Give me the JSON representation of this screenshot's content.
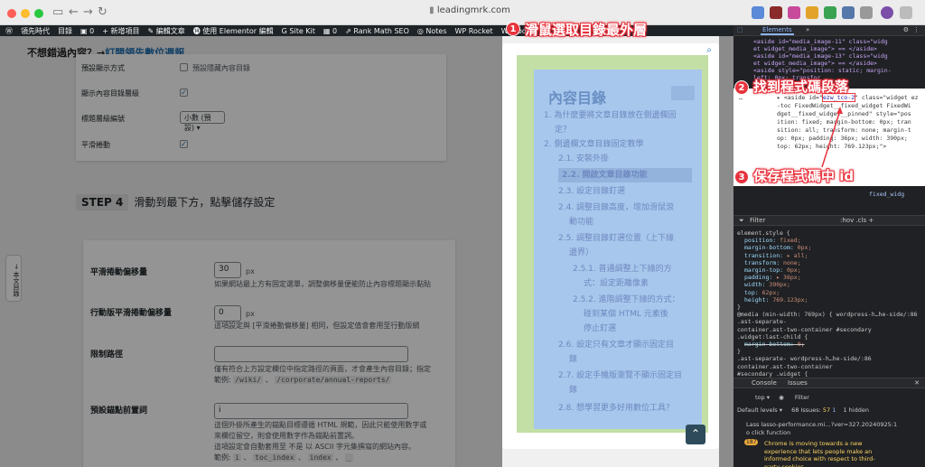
{
  "browser": {
    "url": "leadingmrk.com",
    "nav_icons": [
      "sidebar-icon",
      "back-icon",
      "forward-icon",
      "reload-icon"
    ]
  },
  "wpbar": {
    "items": [
      "領先時代",
      "目錄",
      "0",
      "新增項目",
      "編輯文章",
      "使用 Elementor 編輯",
      "Site Kit",
      "0",
      "Rank Math SEO",
      "Notes",
      "WP Rocket",
      "WPCode"
    ]
  },
  "page": {
    "notice_text": "不想錯過內容？→",
    "notice_link": "訂閱領先數位週報",
    "settings_top": [
      {
        "label": "預設顯示方式",
        "option": "預設隱藏內容目錄",
        "checked": false
      },
      {
        "label": "顯示內容目錄層級",
        "checked": true
      },
      {
        "label": "標題層級編號",
        "select": "小數 (預設)"
      },
      {
        "label": "平滑捲動",
        "checked": true
      }
    ],
    "step_badge": "STEP 4",
    "step_text": "滑動到最下方，點擊儲存設定",
    "smooth_offset_label": "平滑捲動偏移量",
    "smooth_offset_value": "30",
    "smooth_offset_unit": "px",
    "smooth_offset_help": "如果網站最上方有固定選單，調整偏移量便能防止內容標題顯示黏貼",
    "mobile_offset_label": "行動版平滑捲動偏移量",
    "mobile_offset_value": "0",
    "mobile_offset_unit": "px",
    "mobile_offset_help": "這項設定與 [平滑捲動偏移量] 相同，但設定值會套用至行動版網",
    "path_label": "限制路徑",
    "path_help": "僅有符合上方設定欄位中指定路徑的頁面，才會產生內容目錄；指定",
    "path_example_prefix": "範例:",
    "path_example_1": "/wiki/",
    "path_example_sep": "、",
    "path_example_2": "/corporate/annual-reports/",
    "anchor_label": "預設錨點前置詞",
    "anchor_value": "i",
    "anchor_help_1": "這個外掛所產生的錨點目標遵循 HTML 規範，因此只能使用數字或",
    "anchor_help_2": "來欄位留空，則會使用數字作為錨點前置詞。",
    "anchor_help_3": "這項設定會自動套用至 不是 以 ASCII 字元集撰寫的網站內容。",
    "anchor_example_prefix": "範例:",
    "anchor_example_1": "i",
    "anchor_example_2": "toc_index",
    "anchor_example_3": "index",
    "anchor_example_4": "_",
    "side_tab": "本文目錄"
  },
  "toc": {
    "title": "內容目錄",
    "items": [
      {
        "text": "1. 為什麼要將文章目錄放在側邊欄固"
      },
      {
        "text": "定？"
      },
      {
        "text": "2. 側邊欄文章目錄固定教學"
      },
      {
        "text": "2.1. 安裝外掛"
      },
      {
        "text": "2.2. 開啟文章目錄功能"
      },
      {
        "text": "2.3. 設定目錄釘選"
      },
      {
        "text": "2.4. 調整目錄高度，增加滑鼠滾"
      },
      {
        "text": "動功能"
      },
      {
        "text": "2.5. 調整目錄釘選位置（上下緣"
      },
      {
        "text": "邊界）"
      },
      {
        "text": "2.5.1. 普通調整上下緣的方"
      },
      {
        "text": "式：設定距離像素"
      },
      {
        "text": "2.5.2. 進階調整下緣的方式："
      },
      {
        "text": "碰到某個 HTML 元素後"
      },
      {
        "text": "停止釘選"
      },
      {
        "text": "2.6. 設定只有文章才顯示固定目"
      },
      {
        "text": "錄"
      },
      {
        "text": "2.7. 設定手機版瀏覽不顯示固定目"
      },
      {
        "text": "錄"
      },
      {
        "text": "2.8. 想學習更多好用數位工具？"
      }
    ]
  },
  "devtools": {
    "tab_elements": "Elements",
    "dom_lines": [
      "<aside id=\"media_image-11\" class=\"widg",
      "et widget_media_image\"> == </aside>",
      "<aside id=\"media_image-13\" class=\"widg",
      "et widget_media_image\"> == </aside>",
      "<aside style=\"position: static; margin-",
      "left: 0px; transfor",
      "adding: 36p",
      "display: bl"
    ],
    "hl_lines": [
      "▸ <aside id=\"ezw_tco-2\" class=\"widget ez",
      "-toc FixedWidget__fixed_widget FixedWi",
      "dget__fixed_widget__pinned\" style=\"pos",
      "ition: fixed; margin-bottom: 0px; tran",
      "sition: all; transform: none; margin-t",
      "op: 0px; padding: 36px; width: 390px;",
      "top: 62px; height: 769.123px;\">"
    ],
    "id_value": "ezw_tco-2",
    "mid_line": "fixed_widg",
    "filter_label": "Filter",
    "filter_tools": ":hov  .cls  +",
    "styles": [
      {
        "t": "element.style {"
      },
      {
        "p": "position",
        "v": "fixed;"
      },
      {
        "p": "margin-bottom",
        "v": "0px;"
      },
      {
        "p": "transition",
        "v": "▸ all;"
      },
      {
        "p": "transform",
        "v": "none;"
      },
      {
        "p": "margin-top",
        "v": "0px;"
      },
      {
        "p": "padding",
        "v": "▸ 36px;"
      },
      {
        "p": "width",
        "v": "390px;"
      },
      {
        "p": "top",
        "v": "62px;"
      },
      {
        "p": "height",
        "v": "769.123px;"
      },
      {
        "t": "}"
      },
      {
        "t": "@media (min-width: 769px) { wordpress-h…he-side/:86"
      },
      {
        "t": ".ast-separate-"
      },
      {
        "t": "container.ast-two-container #secondary"
      },
      {
        "t": ".widget:last-child {"
      },
      {
        "p": "margin-bottom",
        "v": "0;"
      },
      {
        "t": "}"
      },
      {
        "t": ".ast-separate- wordpress-h…he-side/:86"
      },
      {
        "t": "container.ast-two-container"
      },
      {
        "t": "#secondary .widget {"
      }
    ],
    "console_tab": "Console",
    "issues_tab": "Issues",
    "console_top": "top ▾",
    "console_filter": "Filter",
    "levels": "Default levels ▾",
    "issues_count": "68 Issues:",
    "issues_warn": "57",
    "issues_info": "1",
    "hidden": "1 hidden",
    "console_lines": [
      "Lass lasso-performance.mi…?ver=327.20240925:1",
      "o click function",
      "Chrome is moving towards a new",
      "experience that lets people make an",
      "informed choice with respect to third-",
      "party cookies."
    ],
    "console_badge": "187"
  },
  "annotations": [
    {
      "num": "1",
      "text": "滑鼠選取目錄最外層"
    },
    {
      "num": "2",
      "text": "找到程式碼段落"
    },
    {
      "num": "3",
      "text": "保存程式碼中 id"
    }
  ],
  "colors": {
    "annotation_red": "#e8333d",
    "toc_blue": "#a7c7ec",
    "toc_green": "#c3dfa6",
    "wp_link": "#2271b1"
  }
}
